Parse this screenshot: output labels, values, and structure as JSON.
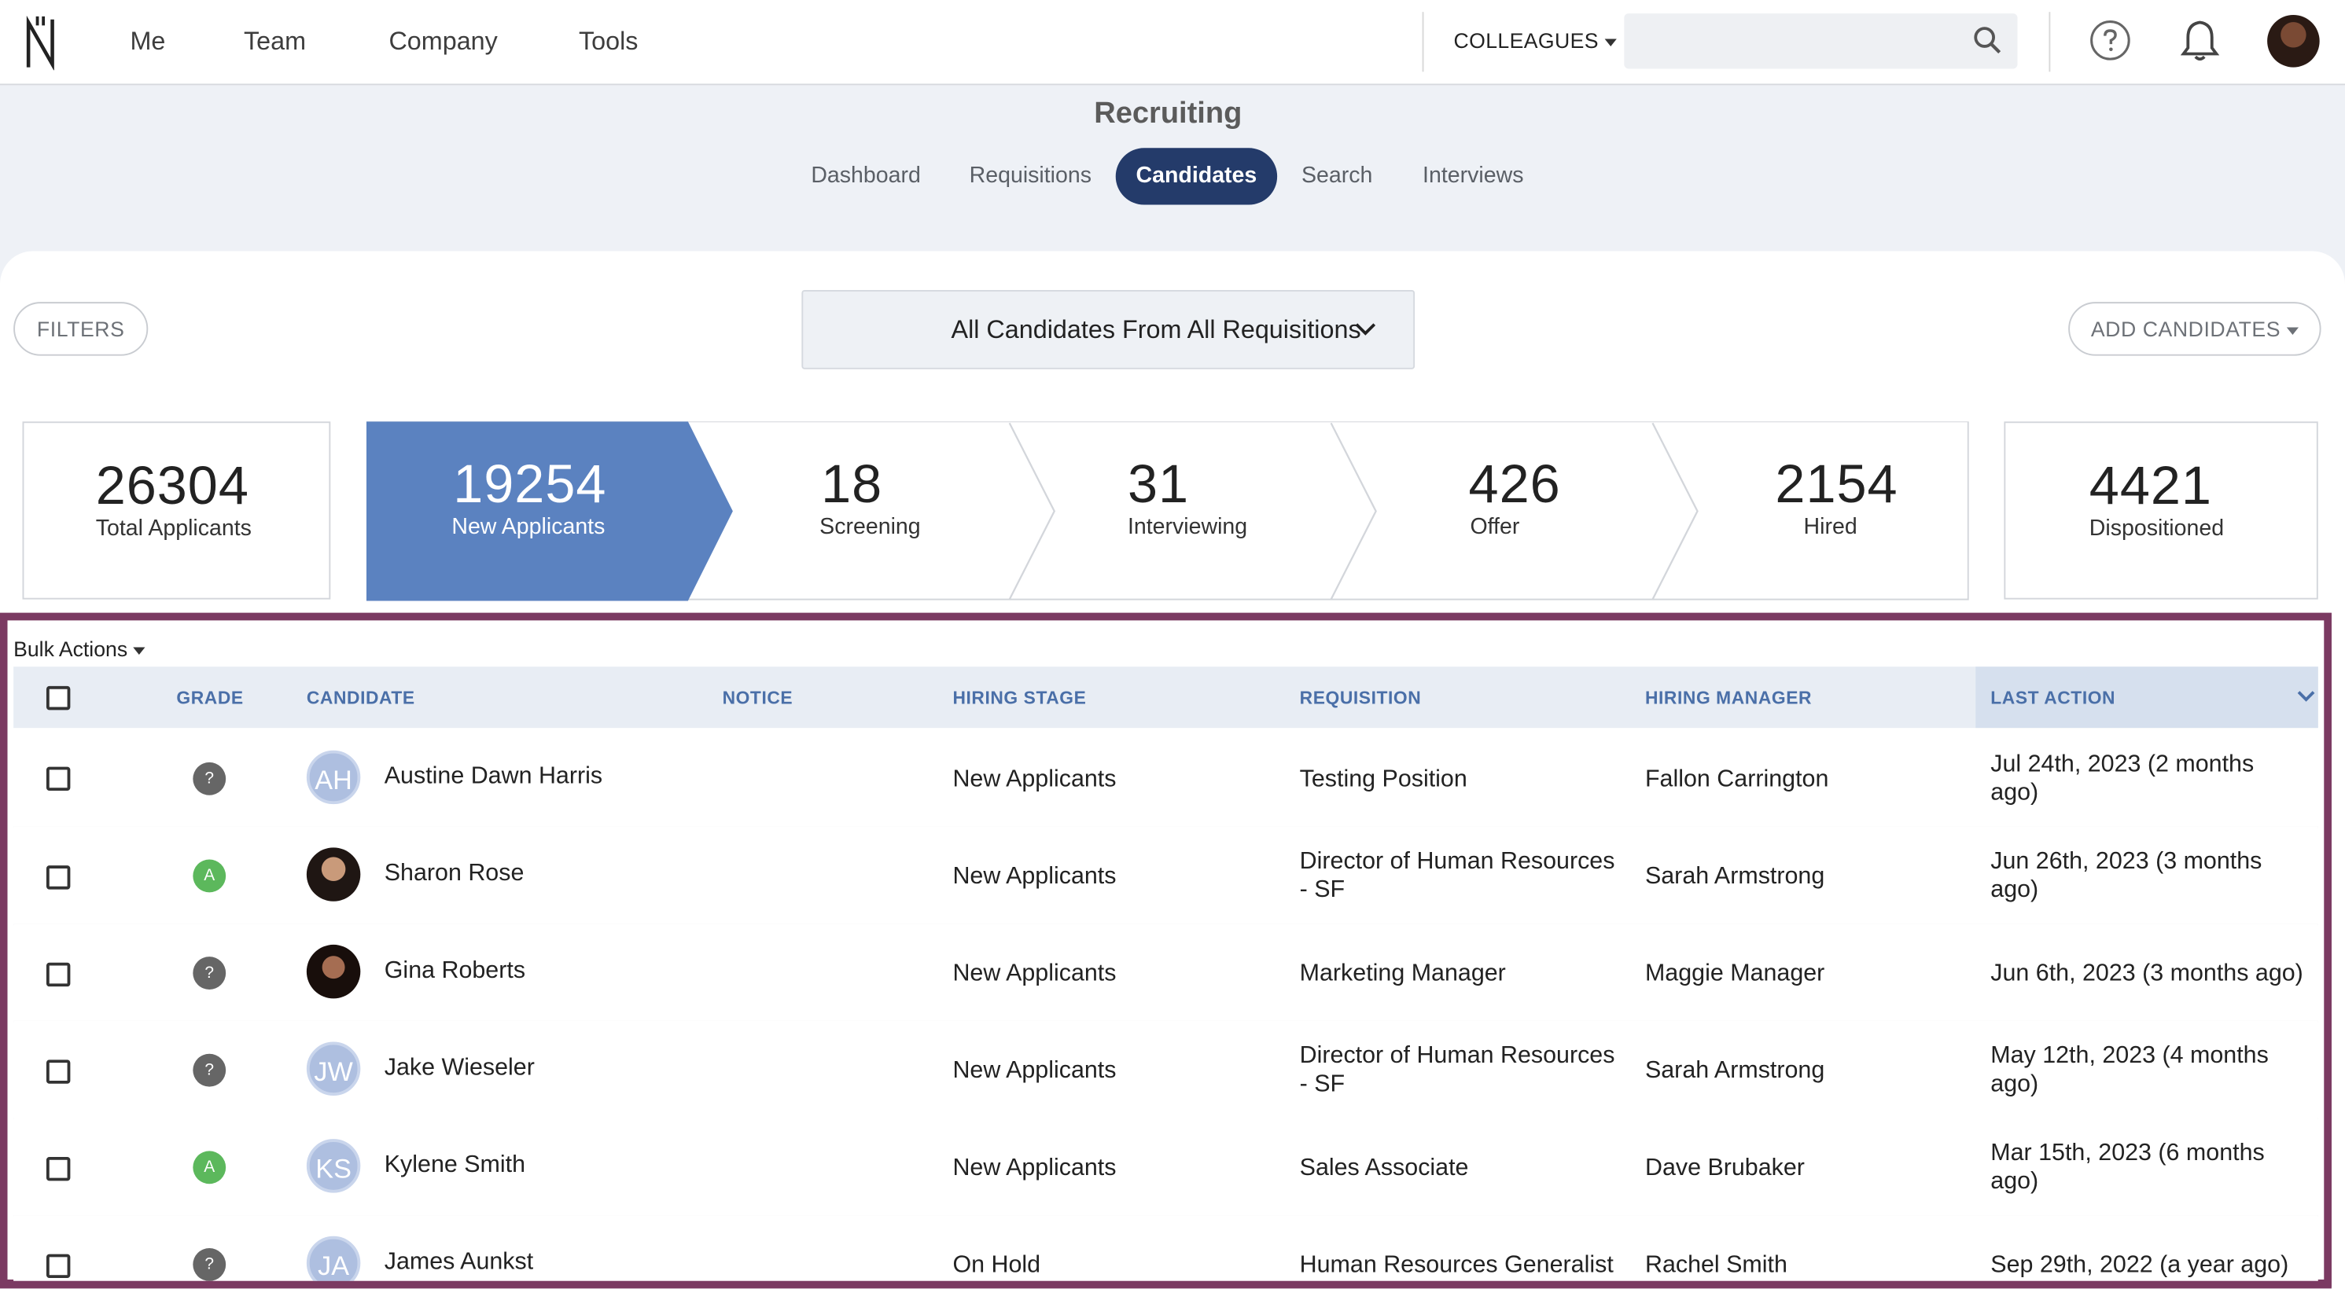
{
  "nav": {
    "items": [
      "Me",
      "Team",
      "Company",
      "Tools"
    ],
    "colleagues_label": "COLLEAGUES",
    "search_placeholder": ""
  },
  "page": {
    "title": "Recruiting",
    "tabs": [
      "Dashboard",
      "Requisitions",
      "Candidates",
      "Search",
      "Interviews"
    ],
    "active_tab": "Candidates"
  },
  "toolbar": {
    "filters_label": "FILTERS",
    "requisition_select": "All Candidates From All Requisitions",
    "add_candidates_label": "ADD CANDIDATES"
  },
  "stats": {
    "total": {
      "value": "26304",
      "label": "Total Applicants"
    },
    "pipeline": [
      {
        "value": "19254",
        "label": "New Applicants"
      },
      {
        "value": "18",
        "label": "Screening"
      },
      {
        "value": "31",
        "label": "Interviewing"
      },
      {
        "value": "426",
        "label": "Offer"
      },
      {
        "value": "2154",
        "label": "Hired"
      }
    ],
    "dispositioned": {
      "value": "4421",
      "label": "Dispositioned"
    }
  },
  "table": {
    "bulk_actions_label": "Bulk Actions",
    "headers": {
      "grade": "GRADE",
      "candidate": "CANDIDATE",
      "notice": "NOTICE",
      "hiring_stage": "HIRING STAGE",
      "requisition": "REQUISITION",
      "hiring_manager": "HIRING MANAGER",
      "last_action": "LAST ACTION"
    },
    "rows": [
      {
        "grade": "?",
        "initials": "AH",
        "name": "Austine Dawn Harris",
        "stage": "New Applicants",
        "req1": "Testing Position",
        "req2": "",
        "manager": "Fallon Carrington",
        "last1": "Jul 24th, 2023 (2 months",
        "last2": "ago)"
      },
      {
        "grade": "A",
        "initials": "",
        "name": "Sharon Rose",
        "stage": "New Applicants",
        "req1": "Director of Human Resources",
        "req2": "- SF",
        "manager": "Sarah Armstrong",
        "last1": "Jun 26th, 2023 (3 months",
        "last2": "ago)"
      },
      {
        "grade": "?",
        "initials": "",
        "name": "Gina Roberts",
        "stage": "New Applicants",
        "req1": "Marketing Manager",
        "req2": "",
        "manager": "Maggie Manager",
        "last1": "Jun 6th, 2023 (3 months ago)",
        "last2": ""
      },
      {
        "grade": "?",
        "initials": "JW",
        "name": "Jake Wieseler",
        "stage": "New Applicants",
        "req1": "Director of Human Resources",
        "req2": "- SF",
        "manager": "Sarah Armstrong",
        "last1": "May 12th, 2023 (4 months",
        "last2": "ago)"
      },
      {
        "grade": "A",
        "initials": "KS",
        "name": "Kylene Smith",
        "stage": "New Applicants",
        "req1": "Sales Associate",
        "req2": "",
        "manager": "Dave Brubaker",
        "last1": "Mar 15th, 2023 (6 months",
        "last2": "ago)"
      },
      {
        "grade": "?",
        "initials": "JA",
        "name": "James Aunkst",
        "stage": "On Hold",
        "req1": "Human Resources Generalist",
        "req2": "",
        "manager": "Rachel Smith",
        "last1": "Sep 29th, 2022 (a year ago)",
        "last2": ""
      }
    ]
  },
  "colors": {
    "accent": "#243b6a",
    "pipeline_active": "#5b82c0",
    "highlight_frame": "#7b3a62",
    "grade_a": "#5cb85c",
    "grade_unknown": "#666666"
  }
}
